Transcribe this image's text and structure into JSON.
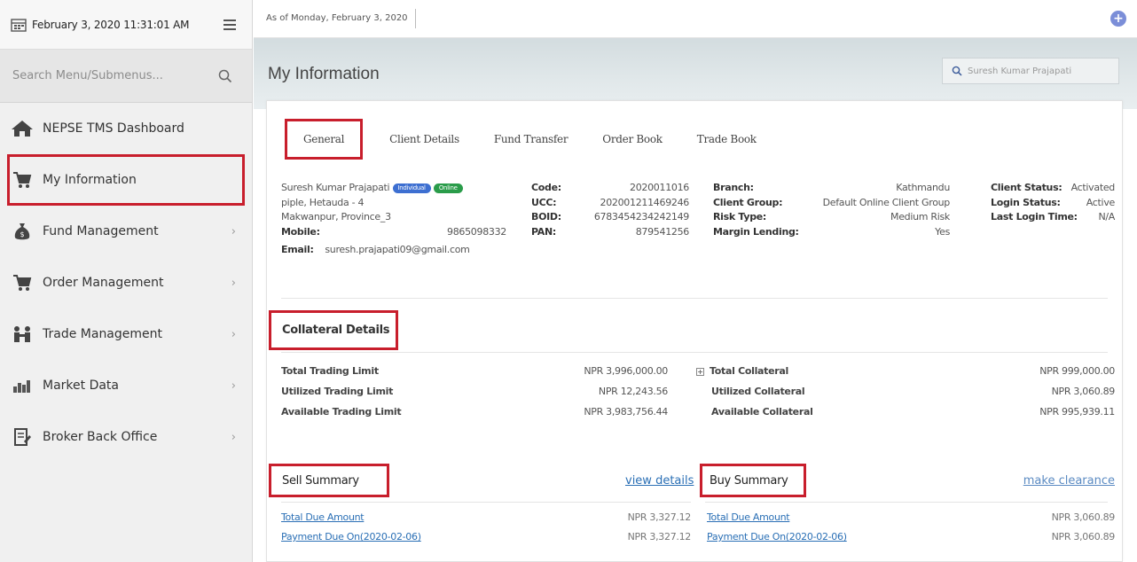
{
  "sidebar": {
    "datetime": "February 3, 2020 11:31:01 AM",
    "search_placeholder": "Search Menu/Submenus...",
    "items": [
      {
        "label": "NEPSE TMS Dashboard"
      },
      {
        "label": "My Information"
      },
      {
        "label": "Fund Management"
      },
      {
        "label": "Order Management"
      },
      {
        "label": "Trade Management"
      },
      {
        "label": "Market Data"
      },
      {
        "label": "Broker Back Office"
      }
    ]
  },
  "topbar": {
    "as_of": "As of Monday, February 3, 2020"
  },
  "header": {
    "title": "My Information",
    "user_search": "Suresh Kumar Prajapati"
  },
  "tabs": [
    "General",
    "Client Details",
    "Fund Transfer",
    "Order Book",
    "Trade Book"
  ],
  "client": {
    "name": "Suresh Kumar Prajapati",
    "badge1": "Individual",
    "badge2": "Online",
    "address1": "piple, Hetauda - 4",
    "address2": "Makwanpur, Province_3",
    "mobile_label": "Mobile:",
    "mobile": "9865098332",
    "email_label": "Email:",
    "email": "suresh.prajapati09@gmail.com",
    "code_label": "Code:",
    "code": "2020011016",
    "ucc_label": "UCC:",
    "ucc": "202001211469246",
    "boid_label": "BOID:",
    "boid": "6783454234242149",
    "pan_label": "PAN:",
    "pan": "879541256",
    "branch_label": "Branch:",
    "branch": "Kathmandu",
    "group_label": "Client Group:",
    "group": "Default Online Client Group",
    "risk_label": "Risk Type:",
    "risk": "Medium Risk",
    "margin_label": "Margin Lending:",
    "margin": "Yes",
    "status_label": "Client Status:",
    "status": "Activated",
    "login_label": "Login Status:",
    "login": "Active",
    "last_label": "Last Login Time:",
    "last": "N/A"
  },
  "collateral": {
    "title": "Collateral Details",
    "rows": [
      {
        "k": "Total Trading Limit",
        "v": "NPR 3,996,000.00",
        "k2": "Total Collateral",
        "v2": "NPR 999,000.00"
      },
      {
        "k": "Utilized Trading Limit",
        "v": "NPR 12,243.56",
        "k2": "Utilized Collateral",
        "v2": "NPR 3,060.89"
      },
      {
        "k": "Available Trading Limit",
        "v": "NPR 3,983,756.44",
        "k2": "Available Collateral",
        "v2": "NPR 995,939.11"
      }
    ]
  },
  "sell": {
    "title": "Sell Summary",
    "link": "view details",
    "rows": [
      {
        "k": "Total Due Amount",
        "v": "NPR 3,327.12"
      },
      {
        "k": "Payment Due On(2020-02-06)",
        "v": "NPR 3,327.12"
      }
    ]
  },
  "buy": {
    "title": "Buy Summary",
    "link": "make clearance",
    "rows": [
      {
        "k": "Total Due Amount",
        "v": "NPR 3,060.89"
      },
      {
        "k": "Payment Due On(2020-02-06)",
        "v": "NPR 3,060.89"
      }
    ]
  },
  "colors": {
    "highlight": "#c81e2c",
    "link": "#2a6fb5",
    "badge_blue": "#3d6fd1",
    "badge_green": "#2a9c4a"
  }
}
